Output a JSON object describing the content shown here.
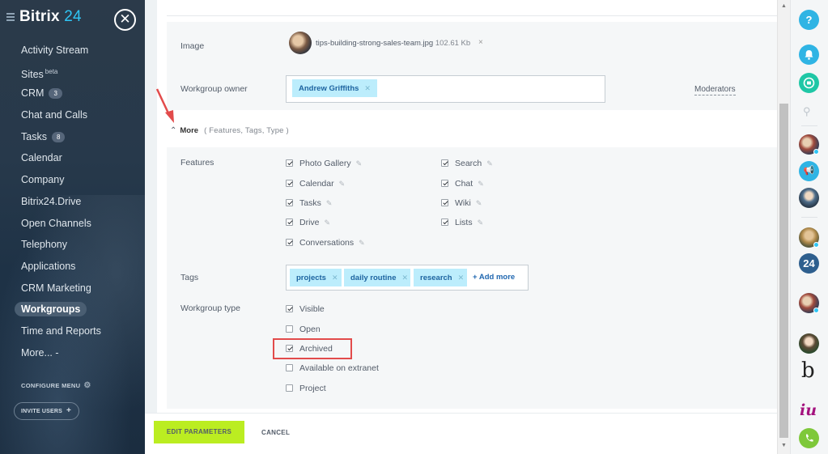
{
  "sidebar": {
    "logo_text": "Bitrix",
    "logo_num": "24",
    "items": [
      {
        "label": "Activity Stream"
      },
      {
        "label": "Sites",
        "sup": "beta"
      },
      {
        "label": "CRM",
        "count": "3"
      },
      {
        "label": "Chat and Calls"
      },
      {
        "label": "Tasks",
        "count": "8"
      },
      {
        "label": "Calendar"
      },
      {
        "label": "Company"
      },
      {
        "label": "Bitrix24.Drive"
      },
      {
        "label": "Open Channels"
      },
      {
        "label": "Telephony"
      },
      {
        "label": "Applications"
      },
      {
        "label": "CRM Marketing"
      },
      {
        "label": "Workgroups",
        "active": true
      },
      {
        "label": "Time and Reports"
      },
      {
        "label": "More...",
        "suffix": "-"
      }
    ],
    "configure_menu": "CONFIGURE MENU",
    "invite_users": "INVITE USERS"
  },
  "form": {
    "image_label": "Image",
    "image_file": "tips-building-strong-sales-team.jpg",
    "image_size": "102.61 Kb",
    "owner_label": "Workgroup owner",
    "owner_value": "Andrew Griffiths",
    "moderators": "Moderators",
    "more_title": "More",
    "more_sub": "( Features,  Tags,  Type  )",
    "features_label": "Features",
    "features_left": [
      {
        "label": "Photo Gallery",
        "checked": true
      },
      {
        "label": "Calendar",
        "checked": true
      },
      {
        "label": "Tasks",
        "checked": true
      },
      {
        "label": "Drive",
        "checked": true
      },
      {
        "label": "Conversations",
        "checked": true
      }
    ],
    "features_right": [
      {
        "label": "Search",
        "checked": true
      },
      {
        "label": "Chat",
        "checked": true
      },
      {
        "label": "Wiki",
        "checked": true
      },
      {
        "label": "Lists",
        "checked": true
      }
    ],
    "tags_label": "Tags",
    "tags": [
      "projects",
      "daily routine",
      "research"
    ],
    "add_more": "Add more",
    "type_label": "Workgroup type",
    "types": [
      {
        "label": "Visible",
        "checked": true
      },
      {
        "label": "Open",
        "checked": false
      },
      {
        "label": "Archived",
        "checked": true
      },
      {
        "label": "Available on extranet",
        "checked": false
      },
      {
        "label": "Project",
        "checked": false
      }
    ]
  },
  "buttons": {
    "edit": "EDIT PARAMETERS",
    "cancel": "CANCEL"
  },
  "rail": {
    "help": "?",
    "badge_24": "24",
    "letter_b": "b",
    "letters_iu": "iu"
  },
  "colors": {
    "accent_green": "#bbed21",
    "chip_bg": "#bcedfc",
    "highlight_red": "#e24b4b",
    "link_blue": "#2067b0"
  }
}
